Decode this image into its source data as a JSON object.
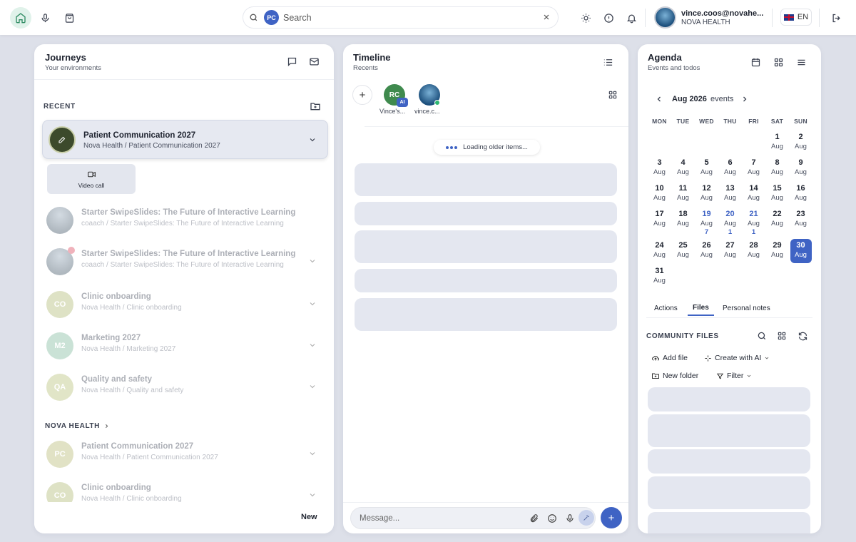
{
  "search": {
    "avatar_initials": "PC",
    "placeholder": "Search"
  },
  "user": {
    "email": "vince.coos@novahe...",
    "org": "NOVA HEALTH"
  },
  "language": {
    "code": "EN"
  },
  "journeys": {
    "title": "Journeys",
    "subtitle": "Your environments",
    "recent_label": "RECENT",
    "active": {
      "title": "Patient Communication 2027",
      "path": "Nova Health / Patient Communication 2027"
    },
    "video_call_label": "Video call",
    "recent_items": [
      {
        "title": "Starter SwipeSlides: The Future of Interactive Learning",
        "path": "coaach / Starter SwipeSlides: The Future of Interactive Learning",
        "initials": ""
      },
      {
        "title": "Starter SwipeSlides: The Future of Interactive Learning",
        "path": "coaach / Starter SwipeSlides: The Future of Interactive Learning",
        "initials": ""
      },
      {
        "title": "Clinic onboarding",
        "path": "Nova Health / Clinic onboarding",
        "initials": "CO"
      },
      {
        "title": "Marketing 2027",
        "path": "Nova Health / Marketing 2027",
        "initials": "M2"
      },
      {
        "title": "Quality and safety",
        "path": "Nova Health / Quality and safety",
        "initials": "QA"
      }
    ],
    "group_label": "NOVA HEALTH",
    "group_items": [
      {
        "title": "Patient Communication 2027",
        "path": "Nova Health / Patient Communication 2027",
        "initials": "PC"
      },
      {
        "title": "Clinic onboarding",
        "path": "Nova Health / Clinic onboarding",
        "initials": "CO"
      }
    ],
    "new_label": "New"
  },
  "timeline": {
    "title": "Timeline",
    "subtitle": "Recents",
    "participants": [
      {
        "initials": "RC",
        "badge": "AI",
        "label": "Vince's..."
      },
      {
        "initials": "",
        "badge": "",
        "label": "vince.c..."
      }
    ],
    "loading_text": "Loading older items...",
    "message_placeholder": "Message..."
  },
  "agenda": {
    "title": "Agenda",
    "subtitle": "Events and todos",
    "month_label": "Aug 2026",
    "events_label": "events",
    "weekdays": [
      "MON",
      "TUE",
      "WED",
      "THU",
      "FRI",
      "SAT",
      "SUN"
    ],
    "month_abbr": "Aug",
    "days": [
      {
        "d": "1",
        "row": 0,
        "col": 5
      },
      {
        "d": "2",
        "row": 0,
        "col": 6
      },
      {
        "d": "3",
        "row": 1,
        "col": 0
      },
      {
        "d": "4",
        "row": 1,
        "col": 1
      },
      {
        "d": "5",
        "row": 1,
        "col": 2
      },
      {
        "d": "6",
        "row": 1,
        "col": 3
      },
      {
        "d": "7",
        "row": 1,
        "col": 4
      },
      {
        "d": "8",
        "row": 1,
        "col": 5
      },
      {
        "d": "9",
        "row": 1,
        "col": 6
      },
      {
        "d": "10",
        "row": 2,
        "col": 0
      },
      {
        "d": "11",
        "row": 2,
        "col": 1
      },
      {
        "d": "12",
        "row": 2,
        "col": 2
      },
      {
        "d": "13",
        "row": 2,
        "col": 3
      },
      {
        "d": "14",
        "row": 2,
        "col": 4
      },
      {
        "d": "15",
        "row": 2,
        "col": 5
      },
      {
        "d": "16",
        "row": 2,
        "col": 6
      },
      {
        "d": "17",
        "row": 3,
        "col": 0
      },
      {
        "d": "18",
        "row": 3,
        "col": 1
      },
      {
        "d": "19",
        "row": 3,
        "col": 2,
        "events": "7"
      },
      {
        "d": "20",
        "row": 3,
        "col": 3,
        "events": "1"
      },
      {
        "d": "21",
        "row": 3,
        "col": 4,
        "events": "1"
      },
      {
        "d": "22",
        "row": 3,
        "col": 5
      },
      {
        "d": "23",
        "row": 3,
        "col": 6
      },
      {
        "d": "24",
        "row": 4,
        "col": 0
      },
      {
        "d": "25",
        "row": 4,
        "col": 1
      },
      {
        "d": "26",
        "row": 4,
        "col": 2
      },
      {
        "d": "27",
        "row": 4,
        "col": 3
      },
      {
        "d": "28",
        "row": 4,
        "col": 4
      },
      {
        "d": "29",
        "row": 4,
        "col": 5
      },
      {
        "d": "30",
        "row": 4,
        "col": 6,
        "selected": true
      },
      {
        "d": "31",
        "row": 5,
        "col": 0
      }
    ],
    "tabs": [
      "Actions",
      "Files",
      "Personal notes"
    ],
    "active_tab": "Files",
    "files_label": "COMMUNITY FILES",
    "add_file": "Add file",
    "create_ai": "Create with AI",
    "new_folder": "New folder",
    "filter": "Filter"
  }
}
